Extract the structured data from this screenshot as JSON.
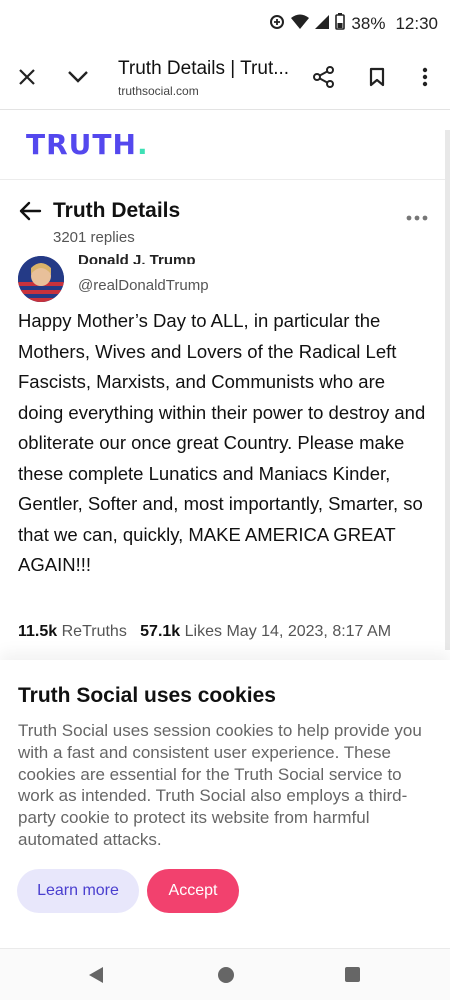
{
  "status_bar": {
    "battery": "38%",
    "time": "12:30",
    "icons": [
      "data-saver-icon",
      "wifi-icon",
      "signal-icon",
      "battery-icon"
    ]
  },
  "browser": {
    "title": "Truth Details | Trut...",
    "url": "truthsocial.com",
    "icons": [
      "close-icon",
      "chevron-down-icon",
      "share-icon",
      "bookmark-icon",
      "more-vert-icon"
    ]
  },
  "brand": {
    "logo_text": "TRUTH",
    "logo_dot": ".",
    "logo_color": "#5448ee",
    "dot_color": "#3ee0b5"
  },
  "details": {
    "title": "Truth Details",
    "replies": "3201 replies"
  },
  "post": {
    "author_name": "Donald J. Trump",
    "handle": "@realDonaldTrump",
    "text": "Happy Mother’s Day to ALL, in particular the Mothers, Wives and Lovers of the Radical Left Fascists, Marxists, and Communists who are doing everything within their power to destroy and obliterate our once great Country. Please make these complete Lunatics and Maniacs Kinder, Gentler, Softer and, most importantly, Smarter, so that we can, quickly, MAKE AMERICA GREAT AGAIN!!!",
    "retruths_count": "11.5k",
    "retruths_label": "ReTruths",
    "likes_count": "57.1k",
    "likes_label": "Likes",
    "timestamp": "May 14, 2023, 8:17 AM"
  },
  "cookie": {
    "title": "Truth Social uses cookies",
    "body": "Truth Social uses session cookies to help provide you with a fast and consistent user experience. These cookies are essential for the Truth Social service to work as intended. Truth Social also employs a third-party cookie to protect its website from harmful automated attacks.",
    "learn_more": "Learn more",
    "accept": "Accept",
    "accept_color": "#f2416e"
  },
  "nav": {
    "icons": [
      "back-triangle-icon",
      "home-circle-icon",
      "recents-square-icon"
    ]
  }
}
